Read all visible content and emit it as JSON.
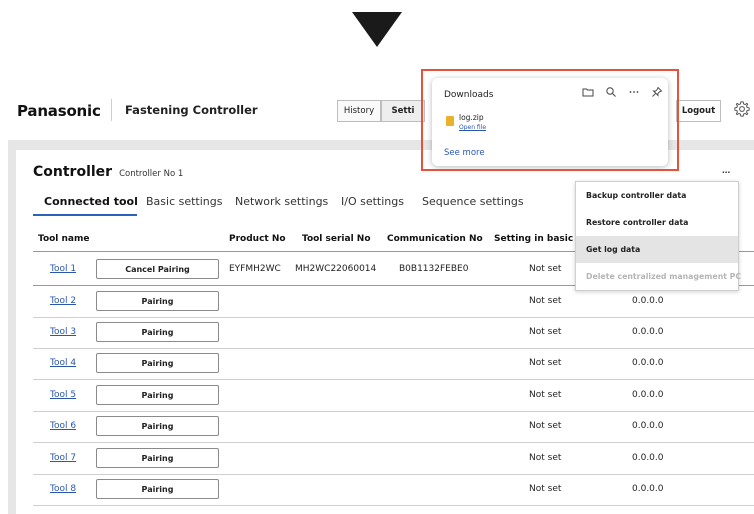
{
  "header": {
    "brand": "Panasonic",
    "app_title": "Fastening Controller",
    "history_label": "History",
    "settings_label": "Setti",
    "logout_label": "Logout"
  },
  "controller": {
    "title": "Controller",
    "subtitle": "Controller No 1",
    "more_label": "..."
  },
  "tabs": [
    {
      "label": "Connected tool",
      "active": true
    },
    {
      "label": "Basic settings"
    },
    {
      "label": "Network settings"
    },
    {
      "label": "I/O settings"
    },
    {
      "label": "Sequence settings"
    }
  ],
  "table": {
    "headers": [
      "Tool name",
      "Product No",
      "Tool serial No",
      "Communication No",
      "Setting in basic n"
    ],
    "rows": [
      {
        "tool": "Tool 1",
        "button": "Cancel Pairing",
        "product": "EYFMH2WC",
        "serial": "MH2WC22060014",
        "comm": "B0B1132FEBE0",
        "setting": "Not set",
        "ip": ""
      },
      {
        "tool": "Tool 2",
        "button": "Pairing",
        "product": "",
        "serial": "",
        "comm": "",
        "setting": "Not set",
        "ip": "0.0.0.0"
      },
      {
        "tool": "Tool 3",
        "button": "Pairing",
        "product": "",
        "serial": "",
        "comm": "",
        "setting": "Not set",
        "ip": "0.0.0.0"
      },
      {
        "tool": "Tool 4",
        "button": "Pairing",
        "product": "",
        "serial": "",
        "comm": "",
        "setting": "Not set",
        "ip": "0.0.0.0"
      },
      {
        "tool": "Tool 5",
        "button": "Pairing",
        "product": "",
        "serial": "",
        "comm": "",
        "setting": "Not set",
        "ip": "0.0.0.0"
      },
      {
        "tool": "Tool 6",
        "button": "Pairing",
        "product": "",
        "serial": "",
        "comm": "",
        "setting": "Not set",
        "ip": "0.0.0.0"
      },
      {
        "tool": "Tool 7",
        "button": "Pairing",
        "product": "",
        "serial": "",
        "comm": "",
        "setting": "Not set",
        "ip": "0.0.0.0"
      },
      {
        "tool": "Tool 8",
        "button": "Pairing",
        "product": "",
        "serial": "",
        "comm": "",
        "setting": "Not set",
        "ip": "0.0.0.0"
      }
    ]
  },
  "downloads": {
    "title": "Downloads",
    "file_name": "log.zip",
    "open_file": "Open file",
    "see_more": "See more",
    "icons": [
      "folder-icon",
      "search-icon",
      "more-icon",
      "pin-icon"
    ]
  },
  "menu": {
    "items": [
      {
        "label": "Backup controller data"
      },
      {
        "label": "Restore controller data"
      },
      {
        "label": "Get log data",
        "selected": true
      },
      {
        "label": "Delete centralized management PC",
        "disabled": true
      }
    ]
  },
  "colors": {
    "accent": "#2a63b8",
    "link": "#2a56b0",
    "highlight": "#e5533d"
  }
}
